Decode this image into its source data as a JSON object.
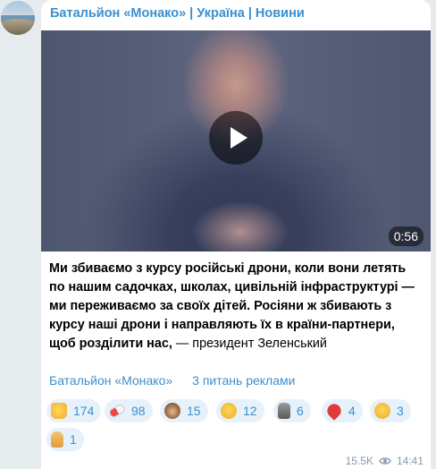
{
  "channel": {
    "title": "Батальйон «Монако» | Україна | Новини"
  },
  "video": {
    "duration": "0:56"
  },
  "message": {
    "text": "Ми збиваємо з курсу російські дрони, коли вони летять по нашим садочках, школах, цивільній інфраструктурі — ми переживаємо за своїх дітей. Росіяни ж збивають з курсу наші дрони і направляють їх в країни-партнери, щоб розділити нас,",
    "author": "— президент Зеленський"
  },
  "links": {
    "channel_link": "Батальйон «Монако»",
    "ads_link": "3 питань реклами"
  },
  "reactions": [
    {
      "icon": "thumbs-up-icon",
      "count": "174"
    },
    {
      "icon": "pill-icon",
      "count": "98"
    },
    {
      "icon": "see-no-evil-monkey-icon",
      "count": "15"
    },
    {
      "icon": "smirk-face-icon",
      "count": "12"
    },
    {
      "icon": "moai-icon",
      "count": "6"
    },
    {
      "icon": "heart-on-fire-icon",
      "count": "4"
    },
    {
      "icon": "thinking-face-icon",
      "count": "3"
    },
    {
      "icon": "folded-hands-icon",
      "count": "1"
    }
  ],
  "footer": {
    "views": "15.5K",
    "time": "14:41"
  },
  "colors": {
    "accent": "#3a8fcf",
    "reaction_bg": "#e7f1fa",
    "page_bg": "#e6ebee"
  }
}
